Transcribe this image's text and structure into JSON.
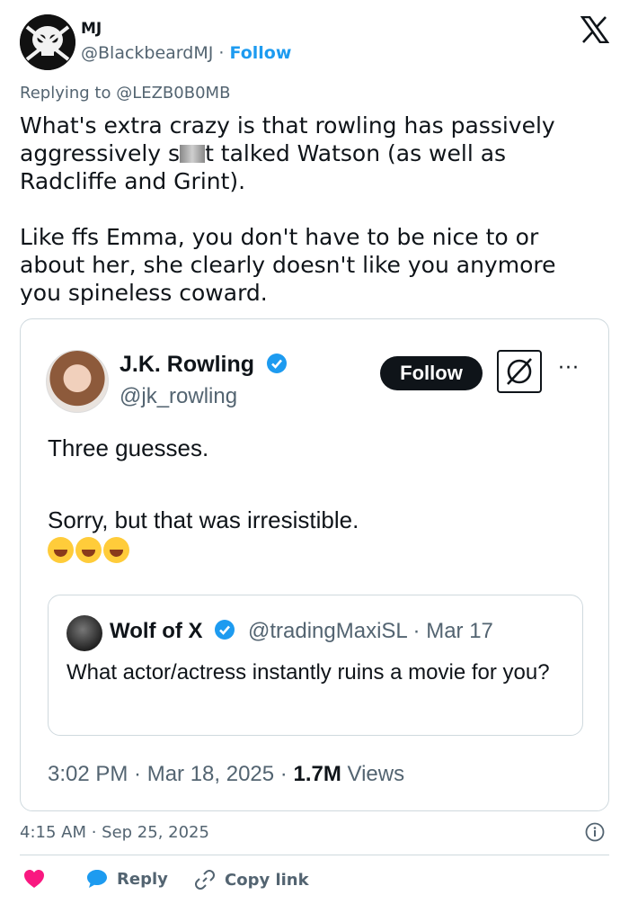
{
  "author": {
    "name": "MJ",
    "handle": "@BlackbeardMJ",
    "separator": "·",
    "follow_label": "Follow"
  },
  "replying_to": "Replying to @LEZB0B0MB",
  "tweet": {
    "text_part1": "What's extra crazy is that rowling has passively\naggressively s",
    "text_part2": "t talked Watson (as well as\nRadcliffe and Grint).\n\nLike ffs Emma, you don't have to be nice to or\nabout her, she clearly doesn't like you anymore\nyou spineless coward."
  },
  "quoted_tweet": {
    "name": "J.K. Rowling",
    "handle": "@jk_rowling",
    "follow_label": "Follow",
    "more_label": "···",
    "line1": "Three guesses.",
    "line2": "Sorry, but that was irresistible.",
    "emoji_icons": [
      "rofl-emoji",
      "rofl-emoji",
      "rofl-emoji"
    ],
    "inner_quote": {
      "name": "Wolf of X",
      "meta": "@tradingMaxiSL · Mar 17",
      "text": "What actor/actress instantly ruins a movie for you?"
    },
    "timestamp": "3:02 PM · Mar 18, 2025 · ",
    "views_count": "1.7M",
    "views_label": " Views"
  },
  "footer": {
    "timestamp": "4:15 AM · Sep 25, 2025",
    "reply_label": "Reply",
    "copy_label": "Copy link"
  },
  "colors": {
    "accent": "#1d9bf0",
    "heart": "#f91880",
    "verified": "#1d9bf0"
  }
}
